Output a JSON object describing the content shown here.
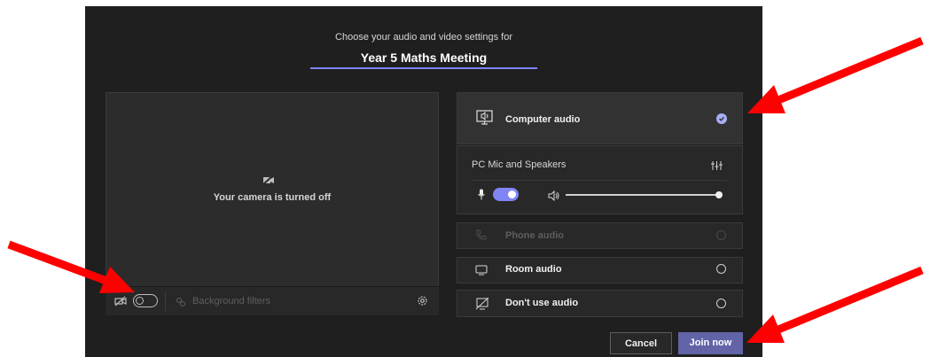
{
  "header": {
    "subtitle": "Choose your audio and video settings for",
    "meeting_title": "Year 5 Maths Meeting"
  },
  "camera": {
    "status_text": "Your camera is turned off",
    "background_filters_label": "Background filters",
    "video_toggle_on": false
  },
  "audio": {
    "options": [
      {
        "label": "Computer audio",
        "selected": true,
        "enabled": true
      },
      {
        "label": "Phone audio",
        "selected": false,
        "enabled": false
      },
      {
        "label": "Room audio",
        "selected": false,
        "enabled": true
      },
      {
        "label": "Don't use audio",
        "selected": false,
        "enabled": true
      }
    ],
    "device_name": "PC Mic and Speakers",
    "mic_toggle_on": true,
    "speaker_volume": 1.0
  },
  "footer": {
    "cancel_label": "Cancel",
    "join_label": "Join now"
  },
  "colors": {
    "background": "#1f1f1f",
    "accent": "#7f85f5",
    "join_button": "#6264a7",
    "annotation_arrow": "#ff0000"
  },
  "annotations": {
    "arrows": [
      "red-arrow-computer-audio",
      "red-arrow-camera-toggle",
      "red-arrow-join-now"
    ]
  }
}
